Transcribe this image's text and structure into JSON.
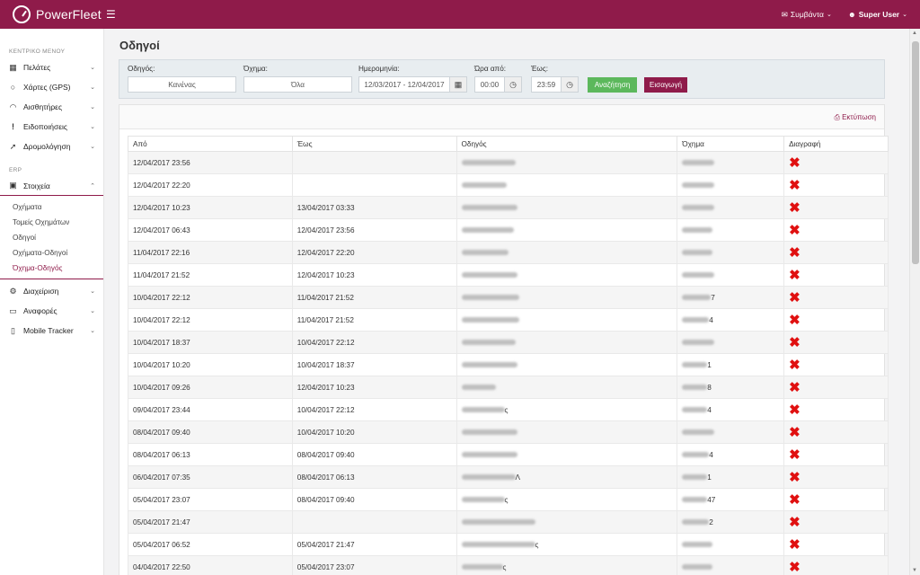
{
  "app": {
    "brand": "PowerFleet",
    "menu_icon": "hamburger-icon"
  },
  "topbar": {
    "events_label": "Συμβάντα",
    "user_label": "Super User"
  },
  "sidebar": {
    "main_section": "ΚΕΝΤΡΙΚΟ ΜΕΝΟΥ",
    "main_items": [
      {
        "label": "Πελάτες",
        "icon": "map-icon"
      },
      {
        "label": "Χάρτες (GPS)",
        "icon": "globe-icon"
      },
      {
        "label": "Αισθητήρες",
        "icon": "gauge-icon"
      },
      {
        "label": "Ειδοποιήσεις",
        "icon": "exclamation-icon"
      },
      {
        "label": "Δρομολόγηση",
        "icon": "location-arrow-icon"
      }
    ],
    "erp_section": "ERP",
    "erp_open": {
      "label": "Στοιχεία",
      "icon": "car-icon"
    },
    "erp_sub": [
      "Οχήματα",
      "Τομείς Οχημάτων",
      "Οδηγοί",
      "Οχήματα-Οδηγοί",
      "Όχημα-Οδηγός"
    ],
    "active_sub_index": 4,
    "other_items": [
      {
        "label": "Διαχείριση",
        "icon": "gear-icon"
      },
      {
        "label": "Αναφορές",
        "icon": "monitor-icon"
      },
      {
        "label": "Mobile Tracker",
        "icon": "mobile-icon"
      }
    ]
  },
  "page": {
    "title": "Οδηγοί"
  },
  "filters": {
    "driver_label": "Οδηγός:",
    "driver_value": "Κανένας",
    "vehicle_label": "Όχημα:",
    "vehicle_value": "Όλα",
    "date_label": "Ημερομηνία:",
    "date_value": "12/03/2017 - 12/04/2017",
    "time_from_label": "Ώρα από:",
    "time_from_value": "00:00",
    "time_to_label": "Έως:",
    "time_to_value": "23:59",
    "search_button": "Αναζήτηση",
    "insert_button": "Εισαγωγή"
  },
  "table": {
    "print_label": "Εκτύπωση",
    "columns": [
      "Από",
      "Έως",
      "Οδηγός",
      "Όχημα",
      "Διαγραφή"
    ],
    "rows": [
      {
        "from": "12/04/2017 23:56",
        "to": "",
        "driver_tail": "",
        "vehicle_tail": ""
      },
      {
        "from": "12/04/2017 22:20",
        "to": "",
        "driver_tail": "",
        "vehicle_tail": ""
      },
      {
        "from": "12/04/2017 10:23",
        "to": "13/04/2017 03:33",
        "driver_tail": "",
        "vehicle_tail": ""
      },
      {
        "from": "12/04/2017 06:43",
        "to": "12/04/2017 23:56",
        "driver_tail": "",
        "vehicle_tail": ""
      },
      {
        "from": "11/04/2017 22:16",
        "to": "12/04/2017 22:20",
        "driver_tail": "",
        "vehicle_tail": ""
      },
      {
        "from": "11/04/2017 21:52",
        "to": "12/04/2017 10:23",
        "driver_tail": "",
        "vehicle_tail": ""
      },
      {
        "from": "10/04/2017 22:12",
        "to": "11/04/2017 21:52",
        "driver_tail": "",
        "vehicle_tail": "7"
      },
      {
        "from": "10/04/2017 22:12",
        "to": "11/04/2017 21:52",
        "driver_tail": "",
        "vehicle_tail": "4"
      },
      {
        "from": "10/04/2017 18:37",
        "to": "10/04/2017 22:12",
        "driver_tail": "",
        "vehicle_tail": ""
      },
      {
        "from": "10/04/2017 10:20",
        "to": "10/04/2017 18:37",
        "driver_tail": "",
        "vehicle_tail": "1"
      },
      {
        "from": "10/04/2017 09:26",
        "to": "12/04/2017 10:23",
        "driver_tail": "",
        "vehicle_tail": "8"
      },
      {
        "from": "09/04/2017 23:44",
        "to": "10/04/2017 22:12",
        "driver_tail": "ς",
        "vehicle_tail": "4"
      },
      {
        "from": "08/04/2017 09:40",
        "to": "10/04/2017 10:20",
        "driver_tail": "",
        "vehicle_tail": ""
      },
      {
        "from": "08/04/2017 06:13",
        "to": "08/04/2017 09:40",
        "driver_tail": "",
        "vehicle_tail": "4"
      },
      {
        "from": "06/04/2017 07:35",
        "to": "08/04/2017 06:13",
        "driver_tail": "Λ",
        "vehicle_tail": "1"
      },
      {
        "from": "05/04/2017 23:07",
        "to": "08/04/2017 09:40",
        "driver_tail": "ς",
        "vehicle_tail": "47"
      },
      {
        "from": "05/04/2017 21:47",
        "to": "",
        "driver_tail": "",
        "vehicle_tail": "2"
      },
      {
        "from": "05/04/2017 06:52",
        "to": "05/04/2017 21:47",
        "driver_tail": "ς",
        "vehicle_tail": ""
      },
      {
        "from": "04/04/2017 22:50",
        "to": "05/04/2017 23:07",
        "driver_tail": "ς",
        "vehicle_tail": ""
      }
    ],
    "delete_glyph": "✖"
  },
  "colors": {
    "brand": "#8f1b4a",
    "search_button": "#5cb85c",
    "delete": "#e01010"
  }
}
